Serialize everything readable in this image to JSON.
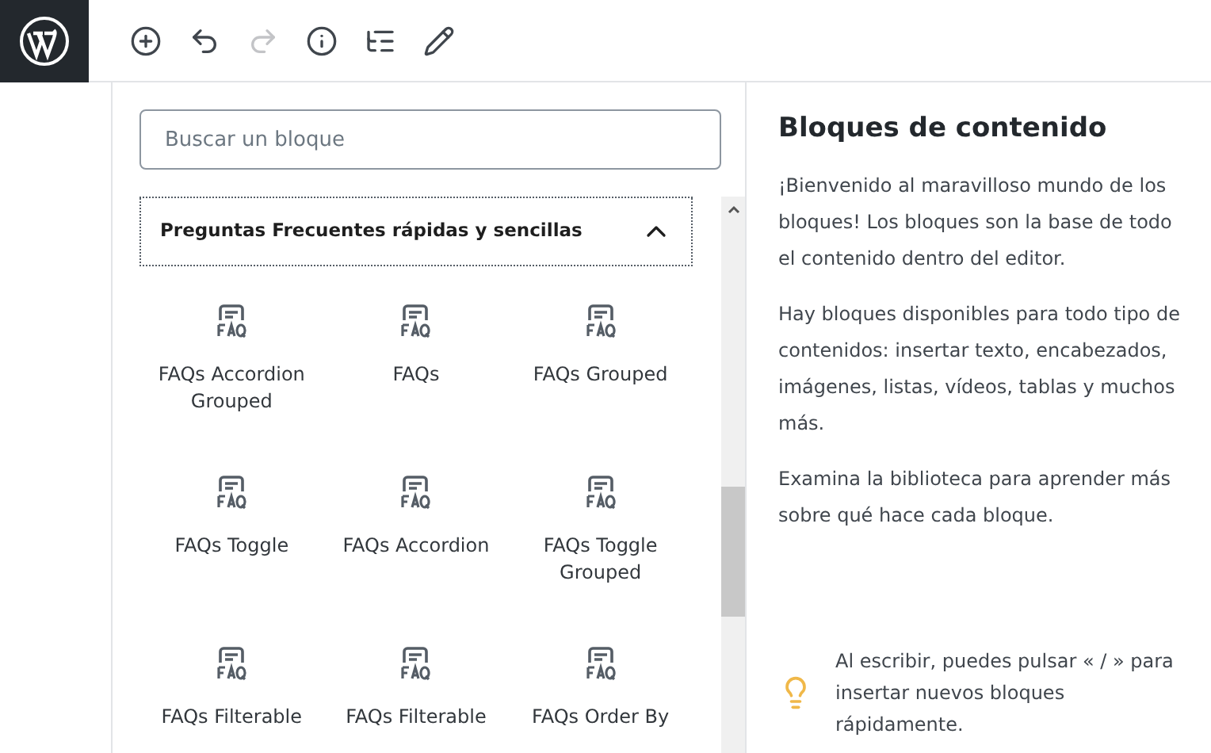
{
  "toolbar": {
    "buttons": [
      {
        "kind": "add",
        "disabled": false
      },
      {
        "kind": "undo",
        "disabled": false
      },
      {
        "kind": "redo",
        "disabled": true
      },
      {
        "kind": "info",
        "disabled": false
      },
      {
        "kind": "list",
        "disabled": false
      },
      {
        "kind": "edit",
        "disabled": false
      }
    ]
  },
  "inserter": {
    "search": {
      "placeholder": "Buscar un bloque"
    },
    "panel": {
      "title": "Preguntas Frecuentes rápidas y sencillas",
      "expanded": true,
      "blocks": [
        {
          "label": "FAQs Accordion Grouped"
        },
        {
          "label": "FAQs"
        },
        {
          "label": "FAQs Grouped"
        },
        {
          "label": "FAQs Toggle"
        },
        {
          "label": "FAQs Accordion"
        },
        {
          "label": "FAQs Toggle Grouped"
        },
        {
          "label": "FAQs Filterable"
        },
        {
          "label": "FAQs Filterable"
        },
        {
          "label": "FAQs Order By"
        }
      ]
    }
  },
  "help": {
    "title": "Bloques de contenido",
    "paragraphs": [
      "¡Bienvenido al maravilloso mundo de los bloques! Los bloques son la base de todo el contenido dentro del editor.",
      "Hay bloques disponibles para todo tipo de contenidos: insertar texto, encabezados, imágenes, listas, vídeos, tablas y muchos más.",
      "Examina la biblioteca para aprender más sobre qué hace cada bloque."
    ],
    "tip": "Al escribir, puedes pulsar « / » para insertar nuevos bloques rápidamente."
  }
}
